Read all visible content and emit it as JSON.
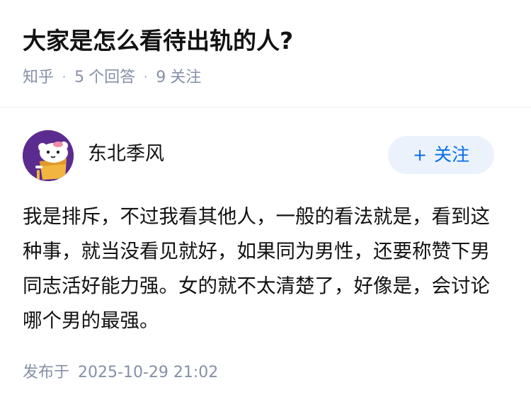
{
  "question": {
    "title": "大家是怎么看待出轨的人?"
  },
  "meta": {
    "source": "知乎",
    "answers_count": "5",
    "answers_label": "个回答",
    "followers_count": "9",
    "followers_label": "关注"
  },
  "author": {
    "name": "东北季风",
    "avatar_icon": "cartoon-avatar-icon",
    "follow_plus": "+",
    "follow_label": "关注"
  },
  "answer": {
    "text": "我是排斥，不过我看其他人，一般的看法就是，看到这种事，就当没看见就好，如果同为男性，还要称赞下男同志活好能力强。女的就不太清楚了，好像是，会讨论哪个男的最强。"
  },
  "footer": {
    "published_label": "发布于",
    "published_date": "2025-10-29 21:02"
  },
  "colors": {
    "text": "#121212",
    "muted": "#8590a6",
    "accent": "#056de8",
    "follow_bg": "#ebf2fb",
    "avatar_bg": "#5b2c8f"
  }
}
